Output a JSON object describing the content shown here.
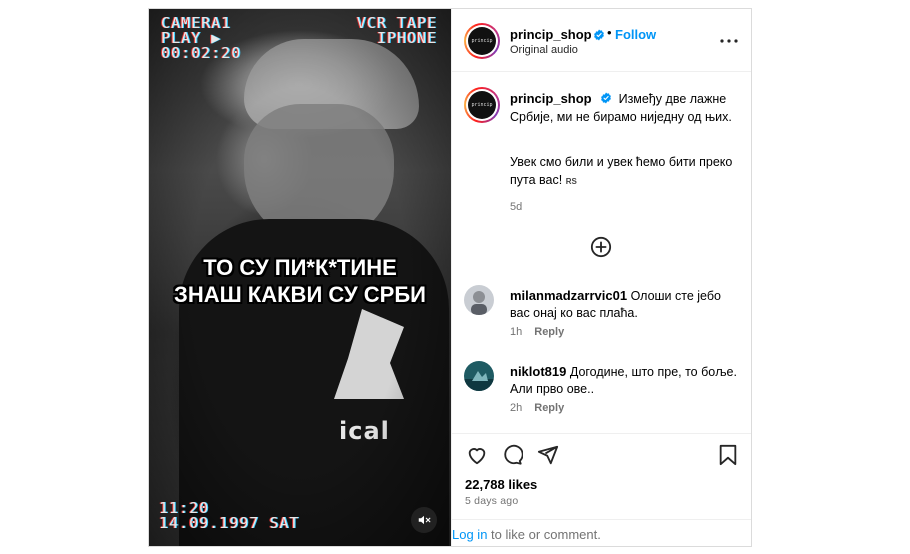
{
  "post": {
    "username": "princip_shop",
    "follow_label": "Follow",
    "separator": "•",
    "audio": "Original audio",
    "avatar_logo_text": "princip"
  },
  "media": {
    "vcr_top_left": [
      "CAMERA1",
      "PLAY ▶",
      "00:02:20"
    ],
    "vcr_top_right": [
      "VCR TAPE",
      "IPHONE"
    ],
    "vcr_bottom_left": [
      "11:20",
      "14.09.1997 SAT"
    ],
    "overlay_line1": "ТО СУ ПИ*К*ТИНЕ",
    "overlay_line2": "ЗНАШ КАКВИ СУ СРБИ",
    "shirt_text": "ical"
  },
  "caption": {
    "username": "princip_shop",
    "line1": "Између две лажне Србије, ми не бирамо ниједну од њих.",
    "line2": "Увек смо били и увек ћемо бити преко пута вас!",
    "flag": "RS",
    "time": "5d"
  },
  "comments": [
    {
      "username": "milanmadzarrvic01",
      "text": "Олоши сте јебо вас онај ко вас плаћа.",
      "time": "1h",
      "reply": "Reply"
    },
    {
      "username": "niklot819",
      "text": "Догодине, што пре, то боље. Али прво ове..",
      "time": "2h",
      "reply": "Reply"
    }
  ],
  "stats": {
    "likes": "22,788 likes",
    "date": "5 days ago"
  },
  "login": {
    "link": "Log in",
    "rest": " to like or comment."
  },
  "colors": {
    "accent": "#0095f6",
    "muted": "#737373",
    "border": "#dbdbdb"
  },
  "icons": [
    "verified-badge-icon",
    "more-options-icon",
    "add-comment-icon",
    "heart-icon",
    "comment-icon",
    "share-icon",
    "save-icon",
    "mute-icon"
  ]
}
